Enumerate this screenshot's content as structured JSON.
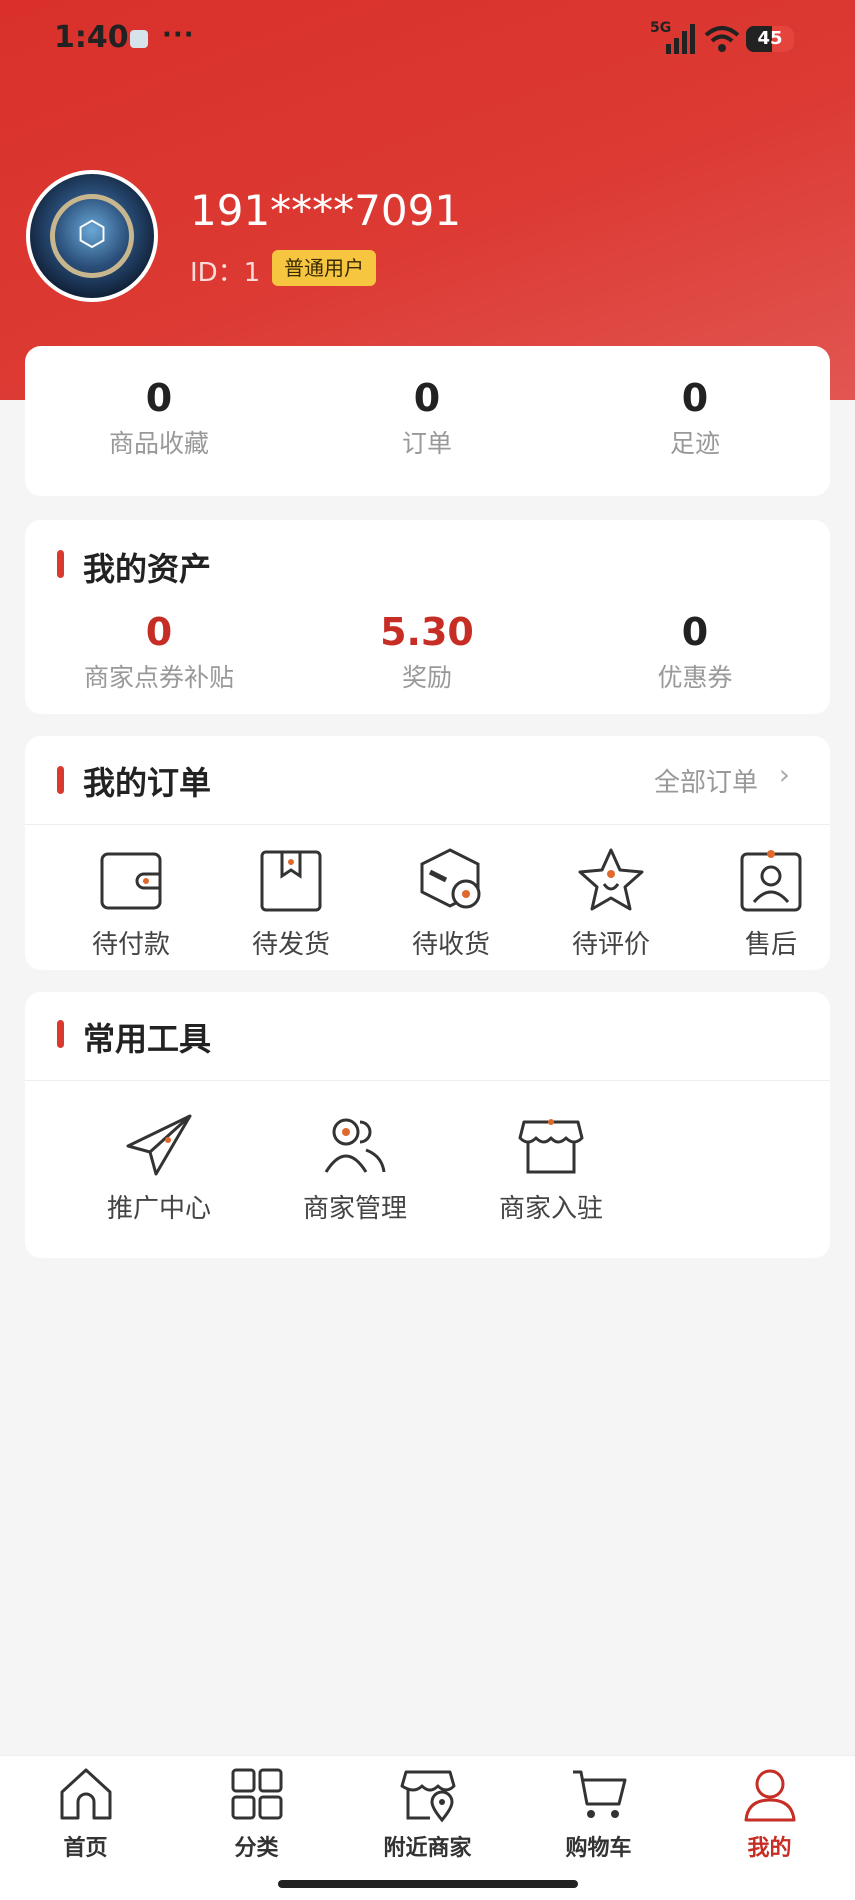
{
  "status": {
    "time": "1:40",
    "dots": "···",
    "network": "5G",
    "battery": "45"
  },
  "profile": {
    "username": "191****7091",
    "id_label": "ID：1",
    "badge": "普通用户"
  },
  "stats": [
    {
      "value": "0",
      "label": "商品收藏"
    },
    {
      "value": "0",
      "label": "订单"
    },
    {
      "value": "0",
      "label": "足迹"
    }
  ],
  "assets": {
    "title": "我的资产",
    "items": [
      {
        "value": "0",
        "label": "商家点券补贴"
      },
      {
        "value": "5.30",
        "label": "奖励"
      },
      {
        "value": "0",
        "label": "优惠券"
      }
    ]
  },
  "orders": {
    "title": "我的订单",
    "all_link": "全部订单",
    "chevron": "›",
    "items": [
      {
        "label": "待付款",
        "icon": "wallet-icon"
      },
      {
        "label": "待发货",
        "icon": "package-icon"
      },
      {
        "label": "待收货",
        "icon": "delivery-box-icon"
      },
      {
        "label": "待评价",
        "icon": "star-icon"
      },
      {
        "label": "售后",
        "icon": "service-badge-icon"
      }
    ]
  },
  "tools": {
    "title": "常用工具",
    "items": [
      {
        "label": "推广中心",
        "icon": "paper-plane-icon"
      },
      {
        "label": "商家管理",
        "icon": "users-icon"
      },
      {
        "label": "商家入驻",
        "icon": "storefront-icon"
      }
    ]
  },
  "tabbar": {
    "items": [
      {
        "label": "首页",
        "icon": "home-icon"
      },
      {
        "label": "分类",
        "icon": "grid-icon"
      },
      {
        "label": "附近商家",
        "icon": "nearby-shop-icon"
      },
      {
        "label": "购物车",
        "icon": "cart-icon"
      },
      {
        "label": "我的",
        "icon": "user-icon",
        "active": true
      }
    ]
  },
  "colors": {
    "accent": "#d83a2f",
    "header_red": "#dc3a33",
    "badge_yellow": "#f7c640",
    "dot_orange": "#e0692e"
  }
}
